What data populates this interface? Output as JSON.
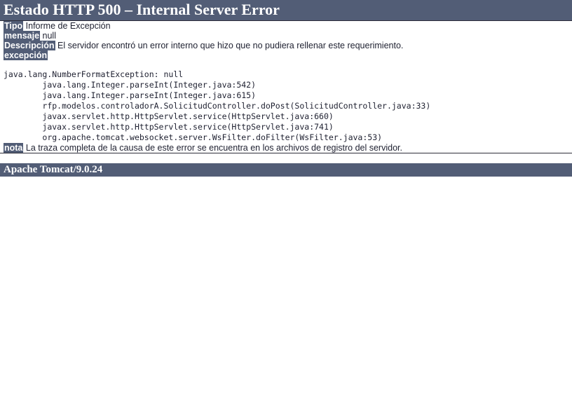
{
  "page": {
    "title": "Estado HTTP 500 – Internal Server Error",
    "footer": "Apache Tomcat/9.0.24",
    "accent_color": "#525D76",
    "text_color": "#1e2030"
  },
  "fields": [
    {
      "label": "Tipo",
      "value": "Informe de Excepción"
    },
    {
      "label": "mensaje",
      "value": "null"
    },
    {
      "label": "Descripción",
      "value": "El servidor encontró un error interno que hizo que no pudiera rellenar este requerimiento."
    }
  ],
  "exception": {
    "label": "excepción",
    "stack_trace": "java.lang.NumberFormatException: null\n\tjava.lang.Integer.parseInt(Integer.java:542)\n\tjava.lang.Integer.parseInt(Integer.java:615)\n\trfp.modelos.controladorA.SolicitudController.doPost(SolicitudController.java:33)\n\tjavax.servlet.http.HttpServlet.service(HttpServlet.java:660)\n\tjavax.servlet.http.HttpServlet.service(HttpServlet.java:741)\n\torg.apache.tomcat.websocket.server.WsFilter.doFilter(WsFilter.java:53)"
  },
  "note": {
    "label": "nota",
    "value": "La traza completa de la causa de este error se encuentra en los archivos de registro del servidor."
  }
}
